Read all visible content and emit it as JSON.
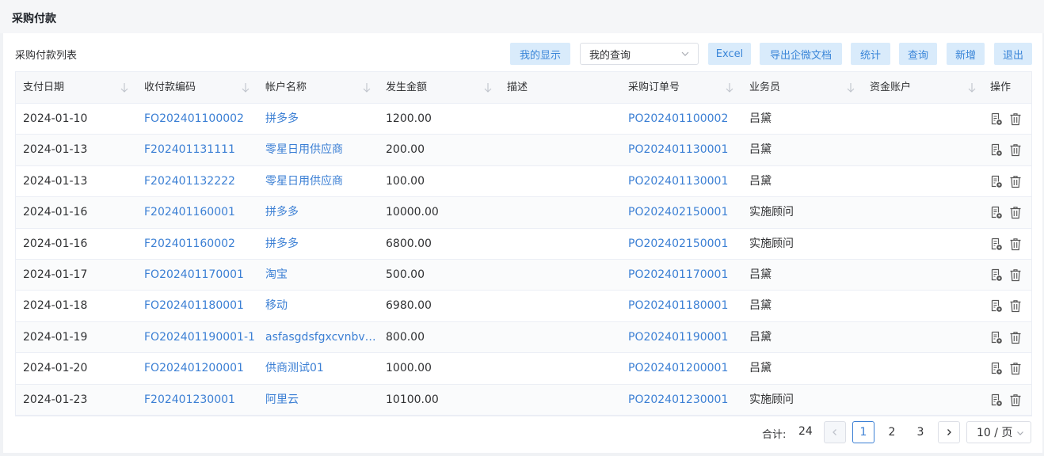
{
  "page": {
    "title": "采购付款"
  },
  "toolbar": {
    "list_title": "采购付款列表",
    "my_display": "我的显示",
    "my_query": "我的查询",
    "excel": "Excel",
    "export_wecom": "导出企微文档",
    "stats": "统计",
    "search": "查询",
    "add": "新增",
    "exit": "退出"
  },
  "table": {
    "headers": [
      "支付日期",
      "收付款编码",
      "帐户名称",
      "发生金额",
      "描述",
      "采购订单号",
      "业务员",
      "资金账户",
      "操作"
    ],
    "rows": [
      [
        "2024-01-10",
        "FO202401100002",
        "拼多多",
        "1200.00",
        "",
        "PO202401100002",
        "吕黛",
        ""
      ],
      [
        "2024-01-13",
        "F202401131111",
        "零星日用供应商",
        "200.00",
        "",
        "PO202401130001",
        "吕黛",
        ""
      ],
      [
        "2024-01-13",
        "F202401132222",
        "零星日用供应商",
        "100.00",
        "",
        "PO202401130001",
        "吕黛",
        ""
      ],
      [
        "2024-01-16",
        "F202401160001",
        "拼多多",
        "10000.00",
        "",
        "PO202402150001",
        "实施顾问",
        ""
      ],
      [
        "2024-01-16",
        "F202401160002",
        "拼多多",
        "6800.00",
        "",
        "PO202402150001",
        "实施顾问",
        ""
      ],
      [
        "2024-01-17",
        "FO202401170001",
        "淘宝",
        "500.00",
        "",
        "PO202401170001",
        "吕黛",
        ""
      ],
      [
        "2024-01-18",
        "FO202401180001",
        "移动",
        "6980.00",
        "",
        "PO202401180001",
        "吕黛",
        ""
      ],
      [
        "2024-01-19",
        "FO202401190001-1",
        "asfasgdsfgxcvnbvc...",
        "800.00",
        "",
        "PO202401190001",
        "吕黛",
        ""
      ],
      [
        "2024-01-20",
        "FO202401200001",
        "供商测试01",
        "1000.00",
        "",
        "PO202401200001",
        "吕黛",
        ""
      ],
      [
        "2024-01-23",
        "F202401230001",
        "阿里云",
        "10100.00",
        "",
        "PO202401230001",
        "实施顾问",
        ""
      ]
    ]
  },
  "pagination": {
    "total_label": "合计:",
    "total": "24",
    "pages": [
      "1",
      "2",
      "3"
    ],
    "current": "1",
    "page_size": "10 / 页"
  },
  "colors": {
    "accent": "#3b7fd4",
    "button_bg": "#d9ebfb"
  },
  "icons": [
    "chevron-down-icon",
    "sort-icon",
    "view-doc-icon",
    "trash-icon",
    "chevron-left-icon",
    "chevron-right-icon"
  ]
}
